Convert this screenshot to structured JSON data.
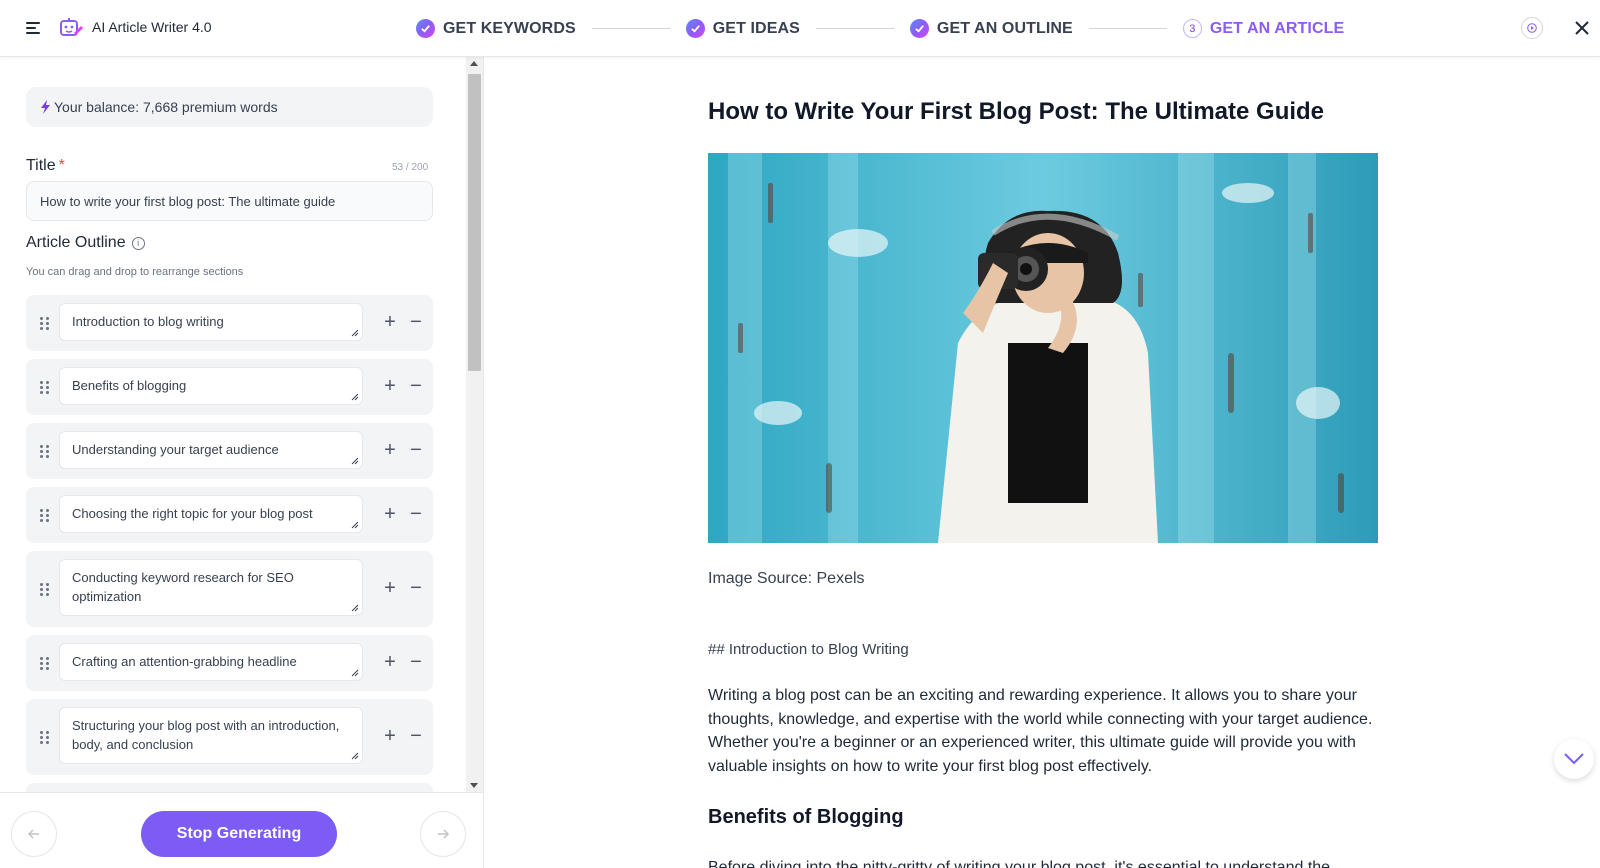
{
  "app": {
    "title": "AI Article Writer 4.0",
    "accent_color": "#7c5cf5"
  },
  "steps": [
    {
      "label": "GET KEYWORDS",
      "status": "done"
    },
    {
      "label": "GET IDEAS",
      "status": "done"
    },
    {
      "label": "GET AN OUTLINE",
      "status": "done"
    },
    {
      "label": "GET AN ARTICLE",
      "status": "active",
      "number": "3"
    }
  ],
  "sidebar": {
    "balance": "Your balance: 7,668 premium words",
    "title_label": "Title",
    "title_required_mark": "*",
    "title_count": "53 / 200",
    "title_value": "How to write your first blog post: The ultimate guide",
    "outline_label": "Article Outline",
    "outline_hint": "You can drag and drop to rearrange sections",
    "sections": [
      "Introduction to blog writing",
      "Benefits of blogging",
      "Understanding your target audience",
      "Choosing the right topic for your blog post",
      "Conducting keyword research for SEO optimization",
      "Crafting an attention-grabbing headline",
      "Structuring your blog post with an introduction, body, and conclusion"
    ],
    "stop_button": "Stop Generating"
  },
  "article": {
    "title": "How to Write Your First Blog Post: The Ultimate Guide",
    "image_source": "Image Source: Pexels",
    "intro_heading": "## Introduction to Blog Writing",
    "intro_paragraph": "Writing a blog post can be an exciting and rewarding experience. It allows you to share your thoughts, knowledge, and expertise with the world while connecting with your target audience. Whether you're a beginner or an experienced writer, this ultimate guide will provide you with valuable insights on how to write your first blog post effectively.",
    "benefits_heading": "Benefits of Blogging",
    "benefits_paragraph": "Before diving into the nitty-gritty of writing your blog post, it's essential to understand the"
  }
}
